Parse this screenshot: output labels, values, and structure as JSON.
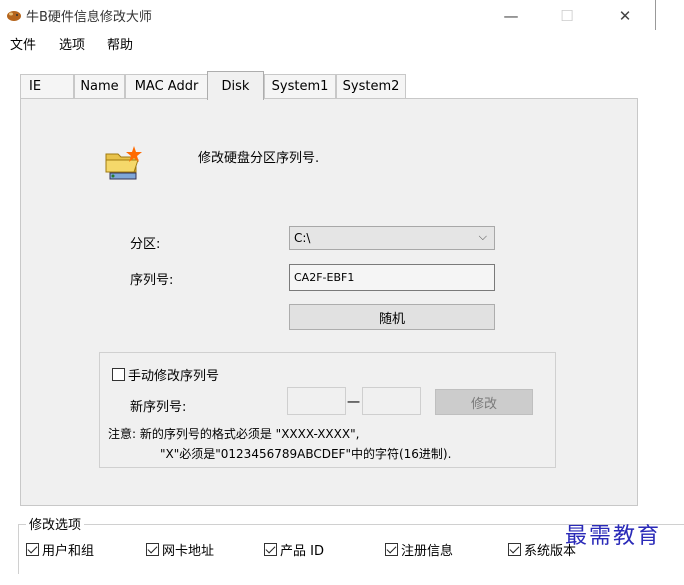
{
  "window": {
    "title": "牛B硬件信息修改大师"
  },
  "menu": {
    "items": [
      "文件",
      "选项",
      "帮助"
    ]
  },
  "tabs": [
    {
      "label": "IE"
    },
    {
      "label": "Name"
    },
    {
      "label": "MAC Addr"
    },
    {
      "label": "Disk",
      "active": true
    },
    {
      "label": "System1"
    },
    {
      "label": "System2"
    }
  ],
  "disk": {
    "heading": "修改硬盘分区序列号.",
    "partition_label": "分区:",
    "partition_value": "C:\\",
    "serial_label": "序列号:",
    "serial_value": "CA2F-EBF1",
    "random_label": "随机",
    "manual_label": "手动修改序列号",
    "new_serial_label": "新序列号:",
    "dash": "一",
    "modify_label": "修改",
    "note_line1": "注意: 新的序列号的格式必须是 \"XXXX-XXXX\",",
    "note_line2": "\"X\"必须是\"0123456789ABCDEF\"中的字符(16进制)."
  },
  "options": {
    "title": "修改选项",
    "items": [
      {
        "label": "用户和组",
        "checked": true
      },
      {
        "label": "网卡地址",
        "checked": true
      },
      {
        "label": "产品 ID",
        "checked": true
      },
      {
        "label": "注册信息",
        "checked": true
      },
      {
        "label": "系统版本",
        "checked": true
      }
    ]
  },
  "watermark": "最需教育"
}
